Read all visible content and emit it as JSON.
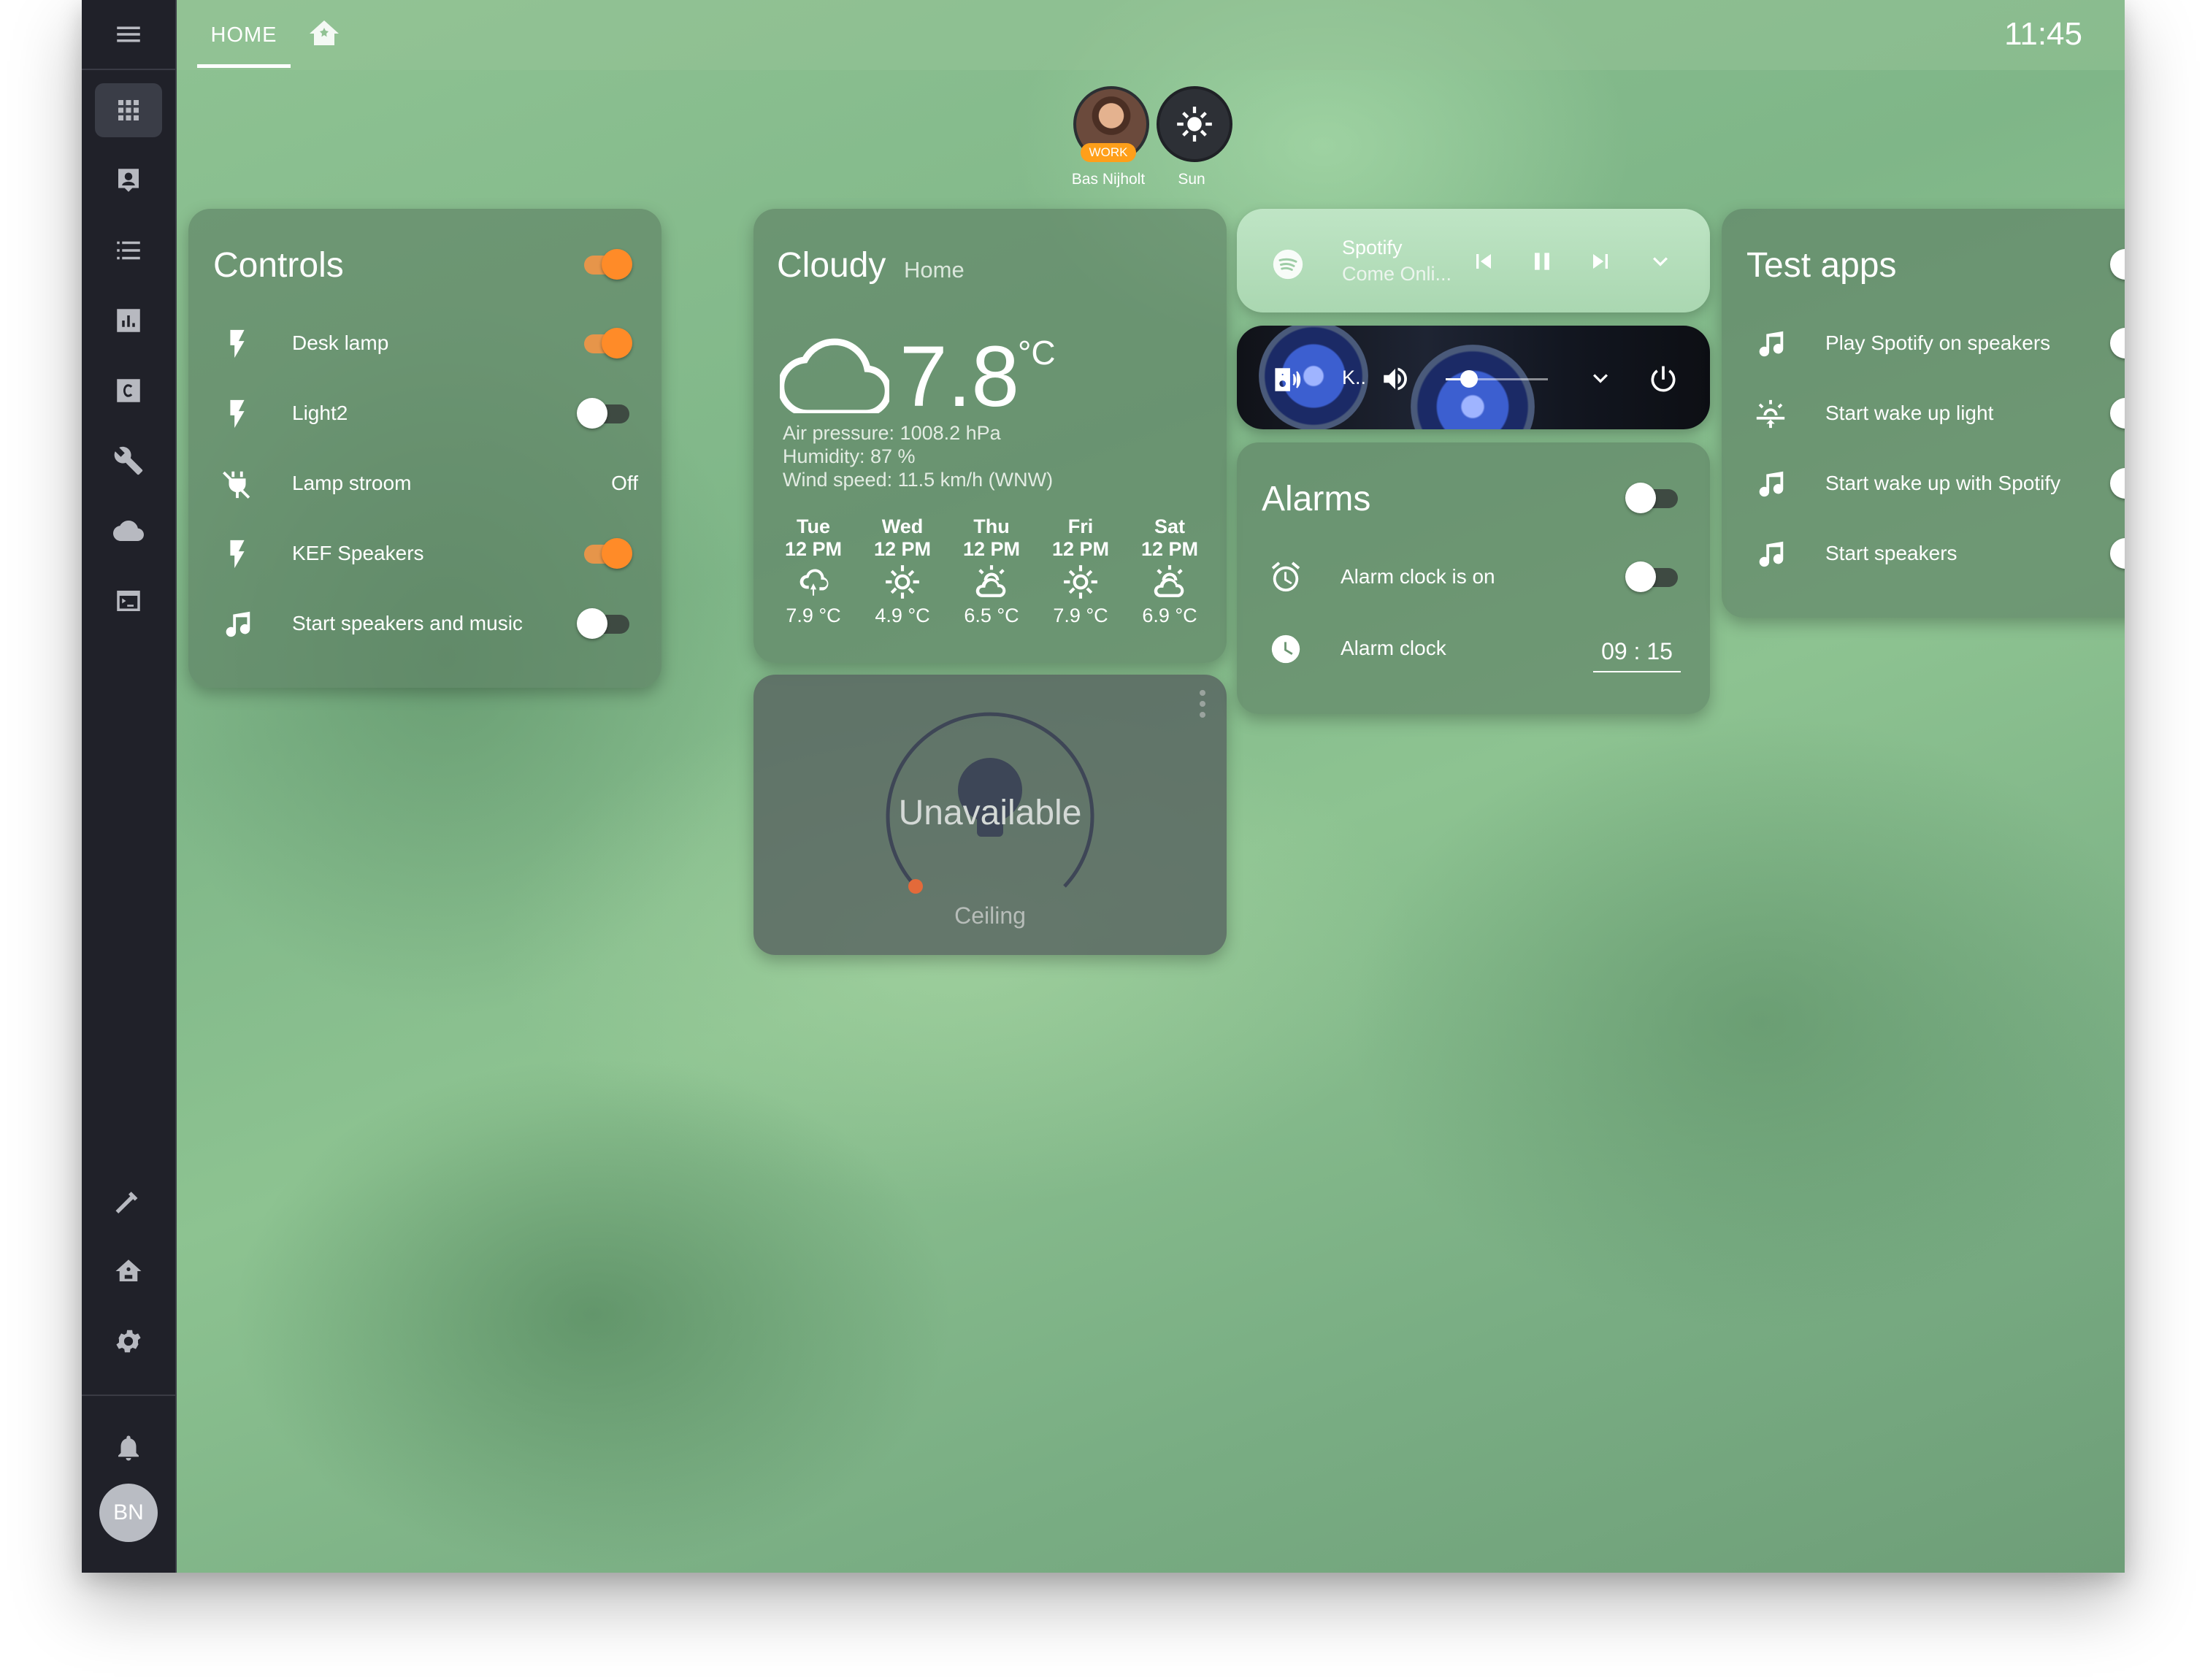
{
  "header": {
    "tab_home": "HOME",
    "time": "11:45"
  },
  "sidebar": {
    "items": [
      "overview-icon",
      "map-icon",
      "logbook-icon",
      "history-icon",
      "hacs-icon",
      "tools-icon",
      "cloud-icon",
      "terminal-icon"
    ],
    "bottom_items": [
      "developer-tools-icon",
      "supervisor-icon",
      "settings-icon",
      "notifications-icon"
    ],
    "user_initials": "BN"
  },
  "badges": [
    {
      "name": "Bas Nijholt",
      "chip": "WORK"
    },
    {
      "name": "Sun"
    }
  ],
  "controls": {
    "title": "Controls",
    "master_on": true,
    "rows": [
      {
        "label": "Desk lamp",
        "icon": "flash-icon",
        "on": true
      },
      {
        "label": "Light2",
        "icon": "flash-icon",
        "on": false
      },
      {
        "label": "Lamp stroom",
        "icon": "power-plug-off-icon",
        "value": "Off"
      },
      {
        "label": "KEF Speakers",
        "icon": "flash-icon",
        "on": true
      },
      {
        "label": "Start speakers and music",
        "icon": "music-note-icon",
        "on": false
      }
    ]
  },
  "weather": {
    "condition": "Cloudy",
    "location": "Home",
    "temperature": "7.8",
    "unit": "°C",
    "pressure": "Air pressure: 1008.2 hPa",
    "humidity": "Humidity: 87 %",
    "wind": "Wind speed: 11.5 km/h (WNW)",
    "forecast": [
      {
        "day": "Tue",
        "time": "12 PM",
        "icon": "rain-cloud-icon",
        "temp": "7.9 °C"
      },
      {
        "day": "Wed",
        "time": "12 PM",
        "icon": "sunny-icon",
        "temp": "4.9 °C"
      },
      {
        "day": "Thu",
        "time": "12 PM",
        "icon": "partly-cloudy-icon",
        "temp": "6.5 °C"
      },
      {
        "day": "Fri",
        "time": "12 PM",
        "icon": "sunny-icon",
        "temp": "7.9 °C"
      },
      {
        "day": "Sat",
        "time": "12 PM",
        "icon": "partly-cloudy-icon",
        "temp": "6.9 °C"
      }
    ]
  },
  "light": {
    "state": "Unavailable",
    "name": "Ceiling"
  },
  "spotify": {
    "title": "Spotify",
    "subtitle": "Come Onli..."
  },
  "kef": {
    "label": "K..",
    "volume_fraction": 0.23
  },
  "alarms": {
    "title": "Alarms",
    "master_on": false,
    "rows": [
      {
        "label": "Alarm clock is on",
        "icon": "alarm-icon",
        "on": false
      },
      {
        "label": "Alarm clock",
        "icon": "clock-icon",
        "value": "09 : 15"
      }
    ]
  },
  "test_apps": {
    "title": "Test apps",
    "master_on": false,
    "rows": [
      {
        "label": "Play Spotify on speakers",
        "icon": "music-note-icon",
        "on": false
      },
      {
        "label": "Start wake up light",
        "icon": "sun-rise-icon",
        "on": false
      },
      {
        "label": "Start wake up with Spotify",
        "icon": "music-note-icon",
        "on": false
      },
      {
        "label": "Start speakers",
        "icon": "music-note-icon",
        "on": false
      }
    ]
  },
  "colors": {
    "toggle_on": "#ff8b28",
    "sidebar": "#202129",
    "accent_light": "#e36a3a"
  }
}
